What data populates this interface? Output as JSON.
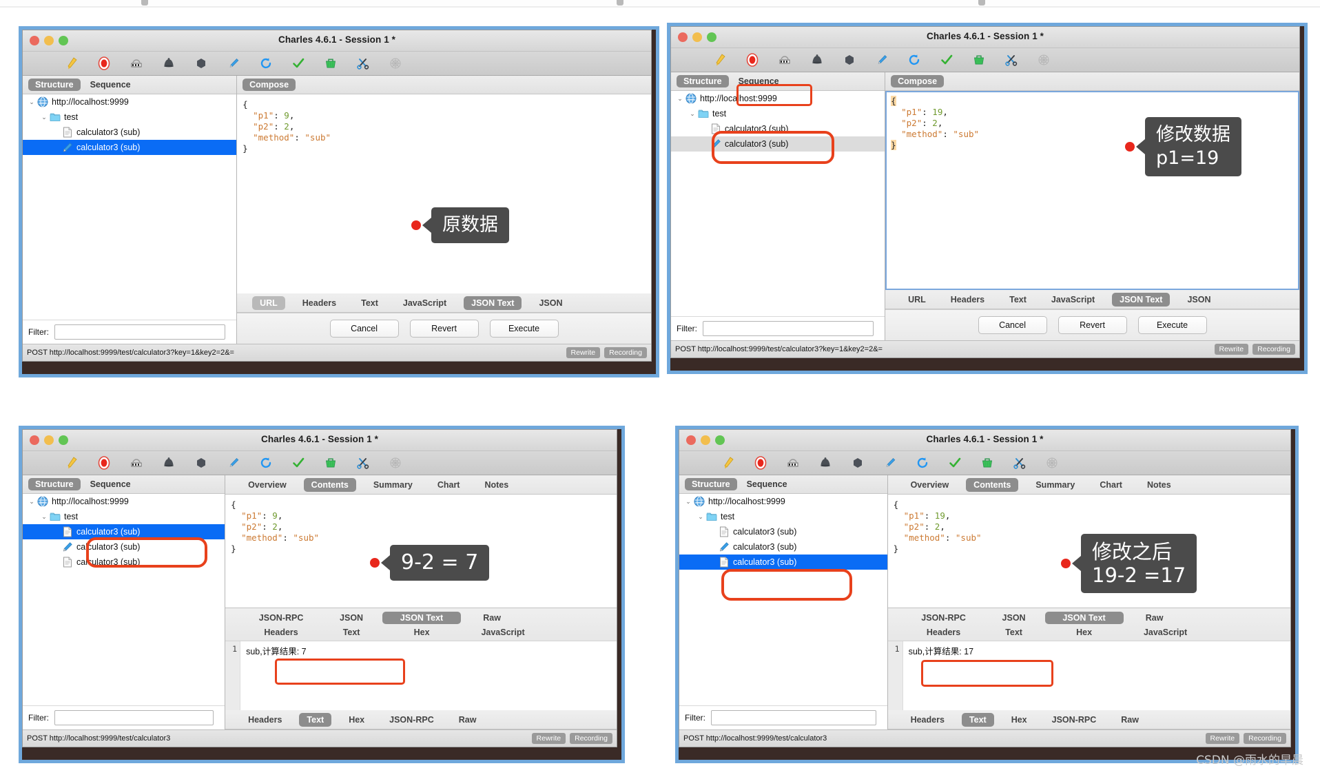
{
  "window": {
    "title": "Charles 4.6.1 - Session 1 *",
    "traffic_lights": [
      "close",
      "minimize",
      "zoom"
    ],
    "toolbar_icons": [
      "clear-broom-icon",
      "record-icon",
      "throttle-icon",
      "breakpoint-icon",
      "hexagon-icon",
      "compose-pen-icon",
      "repeat-refresh-icon",
      "validate-check-icon",
      "basket-icon",
      "scissors-icon",
      "spider-web-icon"
    ]
  },
  "labels": {
    "filter": "Filter:",
    "rewrite": "Rewrite",
    "recording": "Recording",
    "structure": "Structure",
    "sequence": "Sequence",
    "compose": "Compose"
  },
  "tree_icons": {
    "host": "globe-icon",
    "folder": "folder-icon",
    "doc": "document-icon",
    "pen": "pen-icon"
  },
  "panels": [
    {
      "id": "panel-original-request",
      "left": {
        "tabs": [
          {
            "label": "Structure",
            "active": true
          },
          {
            "label": "Sequence",
            "active": false
          }
        ],
        "tree": [
          {
            "label": "http://localhost:9999",
            "icon": "globe-icon",
            "depth": 0,
            "caret": "⌄",
            "state": "none"
          },
          {
            "label": "test",
            "icon": "folder-icon",
            "depth": 1,
            "caret": "⌄",
            "state": "none"
          },
          {
            "label": "calculator3 (sub)",
            "icon": "document-icon",
            "depth": 2,
            "caret": "",
            "state": "none"
          },
          {
            "label": "calculator3 (sub)",
            "icon": "pen-icon",
            "depth": 2,
            "caret": "",
            "state": "selected-blue"
          }
        ]
      },
      "right": {
        "tabs": [
          {
            "label": "Compose",
            "active": true
          }
        ],
        "code_lines": [
          [
            {
              "t": "{",
              "c": "p"
            }
          ],
          [
            {
              "t": "  \"p1\"",
              "c": "k"
            },
            {
              "t": ": ",
              "c": "p"
            },
            {
              "t": "9",
              "c": "n"
            },
            {
              "t": ",",
              "c": "p"
            }
          ],
          [
            {
              "t": "  \"p2\"",
              "c": "k"
            },
            {
              "t": ": ",
              "c": "p"
            },
            {
              "t": "2",
              "c": "n"
            },
            {
              "t": ",",
              "c": "p"
            }
          ],
          [
            {
              "t": "  \"method\"",
              "c": "k"
            },
            {
              "t": ": ",
              "c": "p"
            },
            {
              "t": "\"sub\"",
              "c": "s"
            }
          ],
          [
            {
              "t": "}",
              "c": "p"
            }
          ]
        ],
        "format_tabs": [
          {
            "label": "URL",
            "active": true,
            "style": "light"
          },
          {
            "label": "Headers",
            "active": false
          },
          {
            "label": "Text",
            "active": false
          },
          {
            "label": "JavaScript",
            "active": false
          },
          {
            "label": "JSON Text",
            "active": true
          },
          {
            "label": "JSON",
            "active": false
          }
        ],
        "buttons": [
          "Cancel",
          "Revert",
          "Execute"
        ]
      },
      "status_url": "POST http://localhost:9999/test/calculator3?key=1&key2=2&=",
      "callout": {
        "text": "原数据"
      }
    },
    {
      "id": "panel-modified-request",
      "left": {
        "tabs": [
          {
            "label": "Structure",
            "active": true
          },
          {
            "label": "Sequence",
            "active": false
          }
        ],
        "tree": [
          {
            "label": "http://localhost:9999",
            "icon": "globe-icon",
            "depth": 0,
            "caret": "⌄",
            "state": "none"
          },
          {
            "label": "test",
            "icon": "folder-icon",
            "depth": 1,
            "caret": "⌄",
            "state": "none"
          },
          {
            "label": "calculator3 (sub)",
            "icon": "document-icon",
            "depth": 2,
            "caret": "",
            "state": "none"
          },
          {
            "label": "calculator3 (sub)",
            "icon": "pen-icon",
            "depth": 2,
            "caret": "",
            "state": "selected-grey"
          }
        ]
      },
      "right": {
        "tabs": [
          {
            "label": "Compose",
            "active": true
          }
        ],
        "code_lines": [
          [
            {
              "t": "{",
              "c": "brace"
            }
          ],
          [
            {
              "t": "  \"p1\"",
              "c": "k"
            },
            {
              "t": ": ",
              "c": "p"
            },
            {
              "t": "19",
              "c": "n"
            },
            {
              "t": ",",
              "c": "p"
            }
          ],
          [
            {
              "t": "  \"p2\"",
              "c": "k"
            },
            {
              "t": ": ",
              "c": "p"
            },
            {
              "t": "2",
              "c": "n"
            },
            {
              "t": ",",
              "c": "p"
            }
          ],
          [
            {
              "t": "  \"method\"",
              "c": "k"
            },
            {
              "t": ": ",
              "c": "p"
            },
            {
              "t": "\"sub\"",
              "c": "s"
            }
          ],
          [
            {
              "t": "}",
              "c": "brace"
            }
          ]
        ],
        "format_tabs": [
          {
            "label": "URL",
            "active": false
          },
          {
            "label": "Headers",
            "active": false
          },
          {
            "label": "Text",
            "active": false
          },
          {
            "label": "JavaScript",
            "active": false
          },
          {
            "label": "JSON Text",
            "active": true
          },
          {
            "label": "JSON",
            "active": false
          }
        ],
        "buttons": [
          "Cancel",
          "Revert",
          "Execute"
        ]
      },
      "status_url": "POST http://localhost:9999/test/calculator3?key=1&key2=2&=",
      "callout": {
        "text": "修改数据\np1=19"
      }
    },
    {
      "id": "panel-original-response",
      "left": {
        "tabs": [
          {
            "label": "Structure",
            "active": true
          },
          {
            "label": "Sequence",
            "active": false
          }
        ],
        "tree": [
          {
            "label": "http://localhost:9999",
            "icon": "globe-icon",
            "depth": 0,
            "caret": "⌄",
            "state": "none"
          },
          {
            "label": "test",
            "icon": "folder-icon",
            "depth": 1,
            "caret": "⌄",
            "state": "none"
          },
          {
            "label": "calculator3 (sub)",
            "icon": "document-icon",
            "depth": 2,
            "caret": "",
            "state": "selected-blue"
          },
          {
            "label": "calculator3 (sub)",
            "icon": "pen-icon",
            "depth": 2,
            "caret": "",
            "state": "none"
          },
          {
            "label": "calculator3 (sub)",
            "icon": "document-icon",
            "depth": 2,
            "caret": "",
            "state": "none"
          }
        ]
      },
      "right": {
        "tabs": [
          {
            "label": "Overview",
            "active": false
          },
          {
            "label": "Contents",
            "active": true
          },
          {
            "label": "Summary",
            "active": false
          },
          {
            "label": "Chart",
            "active": false
          },
          {
            "label": "Notes",
            "active": false
          }
        ],
        "code_lines": [
          [
            {
              "t": "{",
              "c": "p"
            }
          ],
          [
            {
              "t": "  \"p1\"",
              "c": "k"
            },
            {
              "t": ": ",
              "c": "p"
            },
            {
              "t": "9",
              "c": "n"
            },
            {
              "t": ",",
              "c": "p"
            }
          ],
          [
            {
              "t": "  \"p2\"",
              "c": "k"
            },
            {
              "t": ": ",
              "c": "p"
            },
            {
              "t": "2",
              "c": "n"
            },
            {
              "t": ",",
              "c": "p"
            }
          ],
          [
            {
              "t": "  \"method\"",
              "c": "k"
            },
            {
              "t": ": ",
              "c": "p"
            },
            {
              "t": "\"sub\"",
              "c": "s"
            }
          ],
          [
            {
              "t": "}",
              "c": "p"
            }
          ]
        ],
        "resp_tabs_row1": [
          {
            "label": "JSON-RPC",
            "active": false
          },
          {
            "label": "JSON",
            "active": false
          },
          {
            "label": "JSON Text",
            "active": true
          },
          {
            "label": "Raw",
            "active": false
          }
        ],
        "resp_tabs_row2": [
          {
            "label": "Headers",
            "active": false
          },
          {
            "label": "Text",
            "active": false
          },
          {
            "label": "Hex",
            "active": false
          },
          {
            "label": "JavaScript",
            "active": false
          }
        ],
        "resp_line_number": "1",
        "resp_line_text": "sub,计算结果: 7",
        "bottom_tabs": [
          {
            "label": "Headers",
            "active": false
          },
          {
            "label": "Text",
            "active": true
          },
          {
            "label": "Hex",
            "active": false
          },
          {
            "label": "JSON-RPC",
            "active": false
          },
          {
            "label": "Raw",
            "active": false
          }
        ]
      },
      "status_url": "POST http://localhost:9999/test/calculator3",
      "callout": {
        "text": "9-2 = 7"
      }
    },
    {
      "id": "panel-modified-response",
      "left": {
        "tabs": [
          {
            "label": "Structure",
            "active": true
          },
          {
            "label": "Sequence",
            "active": false
          }
        ],
        "tree": [
          {
            "label": "http://localhost:9999",
            "icon": "globe-icon",
            "depth": 0,
            "caret": "⌄",
            "state": "none"
          },
          {
            "label": "test",
            "icon": "folder-icon",
            "depth": 1,
            "caret": "⌄",
            "state": "none"
          },
          {
            "label": "calculator3 (sub)",
            "icon": "document-icon",
            "depth": 2,
            "caret": "",
            "state": "none"
          },
          {
            "label": "calculator3 (sub)",
            "icon": "pen-icon",
            "depth": 2,
            "caret": "",
            "state": "none"
          },
          {
            "label": "calculator3 (sub)",
            "icon": "document-icon",
            "depth": 2,
            "caret": "",
            "state": "selected-blue"
          }
        ]
      },
      "right": {
        "tabs": [
          {
            "label": "Overview",
            "active": false
          },
          {
            "label": "Contents",
            "active": true
          },
          {
            "label": "Summary",
            "active": false
          },
          {
            "label": "Chart",
            "active": false
          },
          {
            "label": "Notes",
            "active": false
          }
        ],
        "code_lines": [
          [
            {
              "t": "{",
              "c": "p"
            }
          ],
          [
            {
              "t": "  \"p1\"",
              "c": "k"
            },
            {
              "t": ": ",
              "c": "p"
            },
            {
              "t": "19",
              "c": "n"
            },
            {
              "t": ",",
              "c": "p"
            }
          ],
          [
            {
              "t": "  \"p2\"",
              "c": "k"
            },
            {
              "t": ": ",
              "c": "p"
            },
            {
              "t": "2",
              "c": "n"
            },
            {
              "t": ",",
              "c": "p"
            }
          ],
          [
            {
              "t": "  \"method\"",
              "c": "k"
            },
            {
              "t": ": ",
              "c": "p"
            },
            {
              "t": "\"sub\"",
              "c": "s"
            }
          ],
          [
            {
              "t": "}",
              "c": "p"
            }
          ]
        ],
        "resp_tabs_row1": [
          {
            "label": "JSON-RPC",
            "active": false
          },
          {
            "label": "JSON",
            "active": false
          },
          {
            "label": "JSON Text",
            "active": true
          },
          {
            "label": "Raw",
            "active": false
          }
        ],
        "resp_tabs_row2": [
          {
            "label": "Headers",
            "active": false
          },
          {
            "label": "Text",
            "active": false
          },
          {
            "label": "Hex",
            "active": false
          },
          {
            "label": "JavaScript",
            "active": false
          }
        ],
        "resp_line_number": "1",
        "resp_line_text": "sub,计算结果: 17",
        "bottom_tabs": [
          {
            "label": "Headers",
            "active": false
          },
          {
            "label": "Text",
            "active": true
          },
          {
            "label": "Hex",
            "active": false
          },
          {
            "label": "JSON-RPC",
            "active": false
          },
          {
            "label": "Raw",
            "active": false
          }
        ]
      },
      "status_url": "POST http://localhost:9999/test/calculator3",
      "callout": {
        "text": "修改之后\n19-2 =17"
      }
    }
  ],
  "watermark": "CSDN @雨水的早晨",
  "colors": {
    "frame_blue": "#6fa8dc",
    "selection_blue": "#0a6cf5",
    "annotation_red": "#e8411c",
    "callout_grey": "#4b4b4b",
    "dot_red": "#e8271c"
  }
}
